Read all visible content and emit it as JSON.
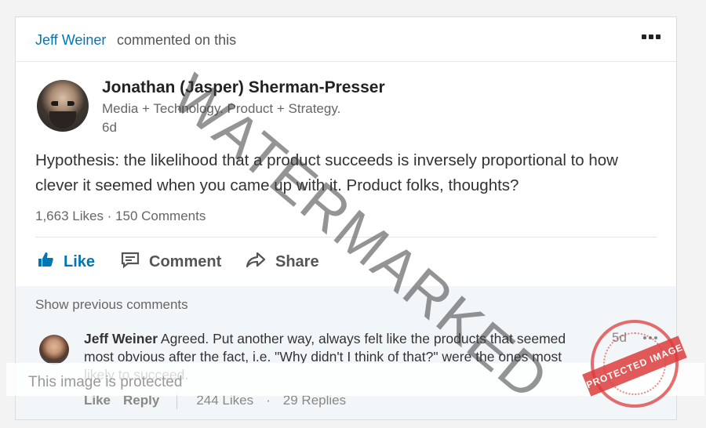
{
  "context": {
    "actor": "Jeff Weiner",
    "verb": "commented on this"
  },
  "post": {
    "author_name": "Jonathan (Jasper) Sherman-Presser",
    "author_headline": "Media + Technology. Product + Strategy.",
    "time": "6d",
    "text": "Hypothesis: the likelihood that a product succeeds is inversely proportional to how clever it seemed when you came up with it. Product folks, thoughts?",
    "stats": "1,663 Likes · 150 Comments"
  },
  "actions": {
    "like": "Like",
    "comment": "Comment",
    "share": "Share"
  },
  "comments": {
    "show_previous": "Show previous comments",
    "item": {
      "author": "Jeff Weiner",
      "text": "Agreed. Put another way, always felt like the products that seemed most obvious after the fact, i.e. \"Why didn't I think of that?\" were the ones most likely to succeed.",
      "time": "5d",
      "like_label": "Like",
      "reply_label": "Reply",
      "likes": "244 Likes",
      "separator": "·",
      "replies": "29 Replies"
    }
  },
  "overlay": {
    "watermark": "WATERMARKED",
    "protected_text": "This image is protected",
    "seal_text": "PROTECTED IMAGE"
  },
  "icons": {
    "more": "more-icon",
    "like": "thumbs-up-icon",
    "comment": "comment-icon",
    "share": "share-arrow-icon"
  },
  "colors": {
    "link": "#0077b5",
    "seal": "#dc3c3c"
  }
}
